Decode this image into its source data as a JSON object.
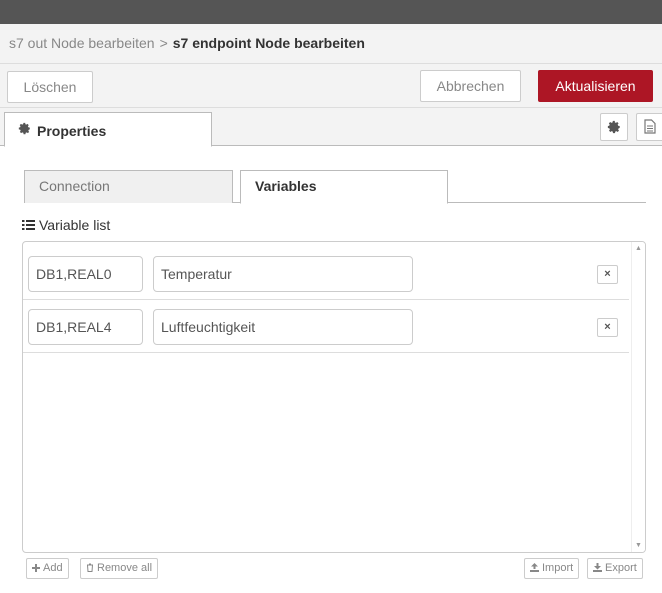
{
  "breadcrumb": {
    "parent": "s7 out Node bearbeiten",
    "separator": ">",
    "current": "s7 endpoint Node bearbeiten"
  },
  "toolbar": {
    "delete_label": "Löschen",
    "cancel_label": "Abbrechen",
    "update_label": "Aktualisieren"
  },
  "tabs": {
    "properties_label": "Properties"
  },
  "subtabs": {
    "connection_label": "Connection",
    "variables_label": "Variables"
  },
  "variable_list": {
    "label": "Variable list",
    "rows": [
      {
        "address": "DB1,REAL0",
        "name": "Temperatur",
        "remove": "×"
      },
      {
        "address": "DB1,REAL4",
        "name": "Luftfeuchtigkeit",
        "remove": "×"
      }
    ],
    "scroll_up": "▲",
    "scroll_down": "▼"
  },
  "list_buttons": {
    "add_label": "Add",
    "remove_all_label": "Remove all",
    "import_label": "Import",
    "export_label": "Export"
  },
  "icons": {
    "properties": "gear-icon",
    "settings": "gear-icon",
    "description": "file-text-icon",
    "list": "list-icon",
    "add": "plus-icon",
    "remove_all": "trash-icon",
    "import": "upload-icon",
    "export": "download-icon"
  },
  "colors": {
    "primary": "#AD1625",
    "topbar": "#555555",
    "panel": "#f3f3f3"
  }
}
